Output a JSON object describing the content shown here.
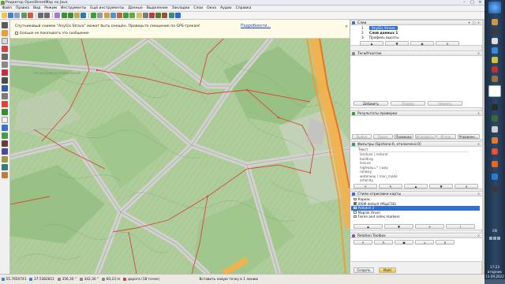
{
  "window": {
    "title": "Редактор OpenStreetMap на Java"
  },
  "menu": [
    "Файл",
    "Правка",
    "Вид",
    "Режим",
    "Инструменты",
    "Ещё инструменты",
    "Данные",
    "Выделение",
    "Закладки",
    "Слои",
    "Окна",
    "Аудио",
    "Справка"
  ],
  "notice": {
    "message": "Спутниковый снимок \"AnyGis Strava\" может быть смещён. Проверьте смещение по GPS-трекам!",
    "link": "Подробности...",
    "checkbox_label": "Больше не показывать это сообщение"
  },
  "map": {
    "faint_label": "Не загружено изображения"
  },
  "layers_panel": {
    "title": "Слои",
    "rows": [
      {
        "num": "1",
        "name": "AnyGis Strava",
        "selected": true
      },
      {
        "num": "2",
        "name": "Слой данных 1",
        "selected": false
      },
      {
        "num": "3",
        "name": "Профиль высоты",
        "selected": false
      }
    ]
  },
  "tags_panel": {
    "title": "Теги/Участие",
    "add_button": "Добавить",
    "edit_button": "Правка",
    "delete_button": "Удалить"
  },
  "validation_panel": {
    "title": "Результаты проверки",
    "buttons": [
      "Выбор",
      "Поиск",
      "Проверка",
      "Исправить",
      "Игнор.",
      "Управлен..."
    ]
  },
  "filter_panel": {
    "title": "Фильтры (Spirtano:0, отключено:0)",
    "header": "Текст",
    "rows": [
      "landuse | natural",
      "building",
      "leisure",
      "highway=* | way",
      "railway",
      "waterway | man_made",
      "amenity"
    ]
  },
  "styles_panel": {
    "title": "Стили отрисовки карты",
    "rows": [
      {
        "name": "Каркас",
        "checked": false,
        "selected": false
      },
      {
        "name": "JOSM default (MapCSS)",
        "checked": true,
        "selected": false
      },
      {
        "name": "Potlatch 2",
        "checked": false,
        "selected": true
      },
      {
        "name": "Mapnik (true)",
        "checked": false,
        "selected": false
      },
      {
        "name": "Fixme and notes markers",
        "checked": false,
        "selected": false
      }
    ]
  },
  "relation_panel": {
    "title": "Relation Toolbox"
  },
  "bottom_buttons": {
    "left": "Создать",
    "right": "Multi"
  },
  "statusbar": {
    "lat": "55.7650741",
    "lon": "37.5382811",
    "heading": "356,30 °",
    "angle": "342,30 °",
    "distance": "60,23 m",
    "way": "дорога (18 точек)",
    "hint": "Вставить новую точку в 1 линию"
  },
  "taskbar": {
    "lang": "EN",
    "time": "17:23",
    "weekday": "вторник",
    "date": "13.09.2022"
  },
  "colors": {
    "map_green": "#aecd9b",
    "road_fill": "#cfcfcf",
    "track_red": "#d8483a",
    "highway_orange": "#f39a33",
    "selection_blue": "#2f6fd6"
  }
}
